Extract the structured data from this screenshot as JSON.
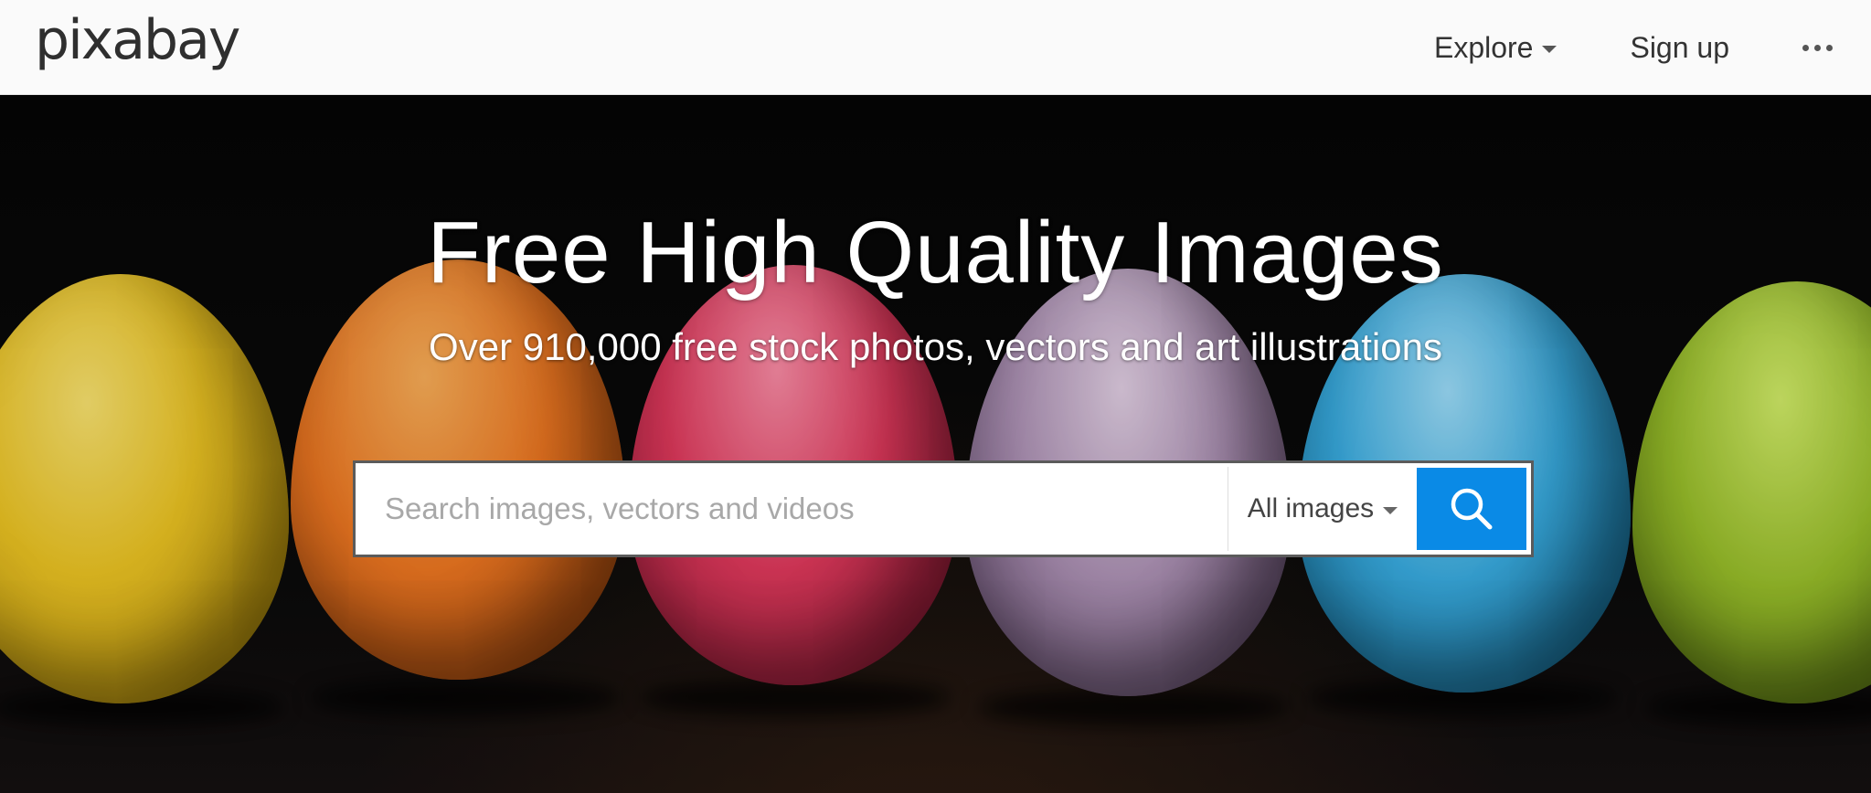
{
  "header": {
    "logo": "pixabay",
    "nav": {
      "explore_label": "Explore",
      "signup_label": "Sign up",
      "more_icon": "more-horizontal-icon"
    }
  },
  "hero": {
    "title": "Free High Quality Images",
    "subtitle": "Over 910,000 free stock photos, vectors and art illustrations",
    "background": "colored-easter-eggs-on-black",
    "search": {
      "placeholder": "Search images, vectors and videos",
      "value": "",
      "type_selected": "All images",
      "button_icon": "search-icon"
    }
  },
  "colors": {
    "accent": "#0a8ae6",
    "header_bg": "#fafafa",
    "hero_bg": "#000000"
  }
}
